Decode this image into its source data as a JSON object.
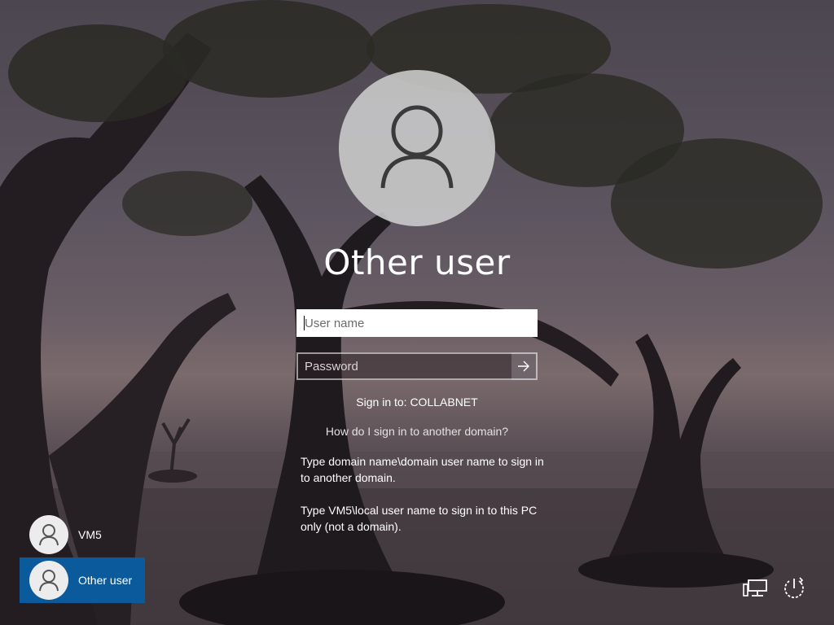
{
  "screen": {
    "title": "Other user",
    "sign_in_to": "Sign in to: COLLABNET",
    "other_domain_link": "How do I sign in to another domain?",
    "help_domain": "Type domain name\\domain user name to sign in to another domain.",
    "help_local": "Type VM5\\local user name to sign in to this PC only (not a domain)."
  },
  "form": {
    "username_placeholder": "User name",
    "username_value": "",
    "password_placeholder": "Password",
    "password_value": "",
    "submit_icon": "arrow-right-icon"
  },
  "users": [
    {
      "label": "VM5",
      "selected": false,
      "icon": "user-icon"
    },
    {
      "label": "Other user",
      "selected": true,
      "icon": "user-icon"
    }
  ],
  "corner": {
    "network_icon": "network-icon",
    "power_icon": "power-icon"
  },
  "colors": {
    "selected_tile": "#0a5a9c",
    "avatar_bg": "#cdcdcd",
    "text": "#ffffff"
  }
}
